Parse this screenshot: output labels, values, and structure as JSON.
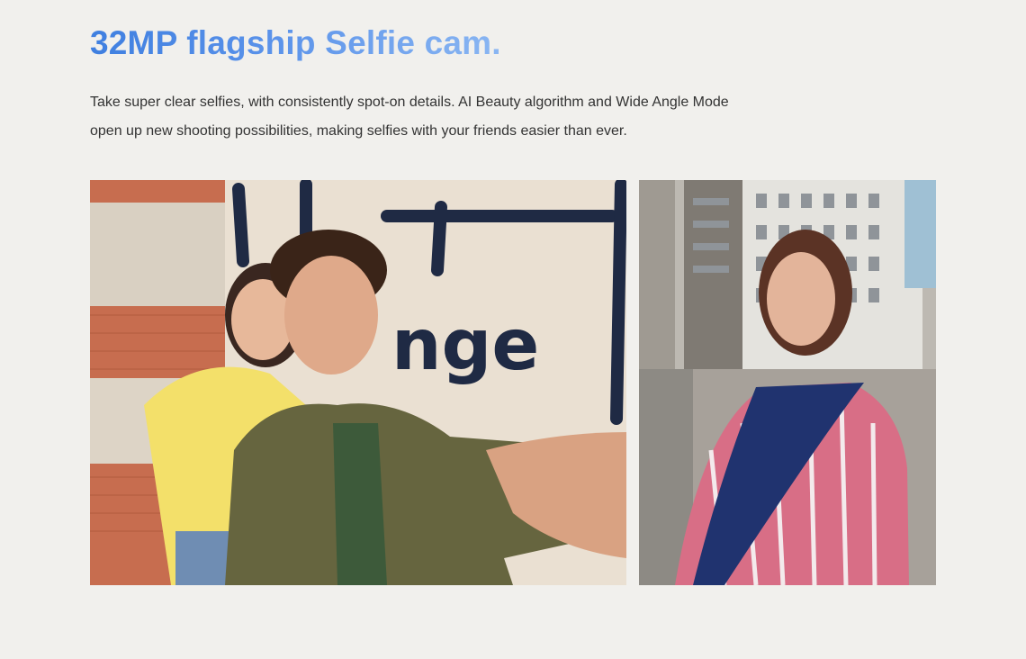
{
  "feature": {
    "headline": "32MP flagship Selfie cam.",
    "description": "Take super clear selfies, with consistently spot-on details. AI Beauty algorithm and Wide Angle Mode open up new shooting possibilities, making selfies with your friends easier than ever."
  },
  "gallery": {
    "items": [
      {
        "name": "couple-selfie-photo",
        "graffiti_text": "nge"
      },
      {
        "name": "street-portrait-photo"
      }
    ]
  },
  "colors": {
    "background": "#f1f0ed",
    "headline_gradient_start": "#3f7fe0",
    "headline_gradient_end": "#8ab6f2",
    "body_text": "#333333"
  }
}
